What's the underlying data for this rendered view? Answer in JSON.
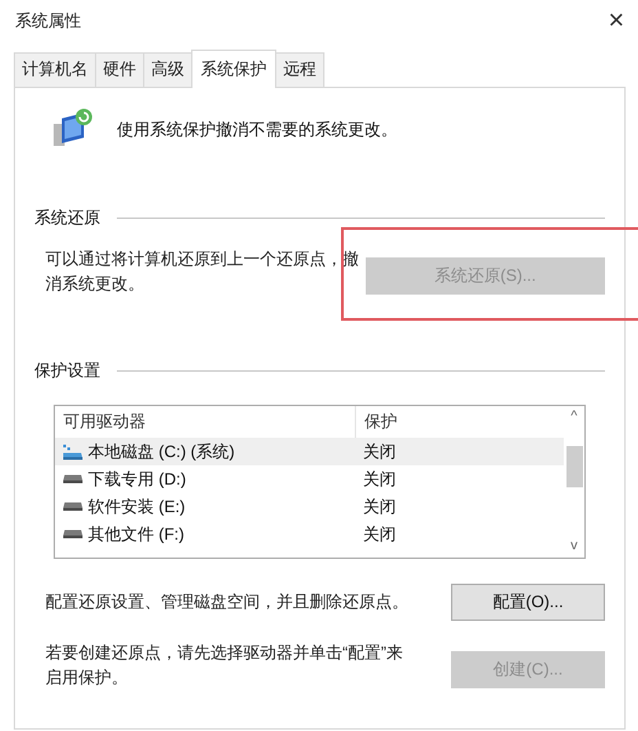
{
  "window": {
    "title": "系统属性",
    "close": "×"
  },
  "tabs": [
    {
      "label": "计算机名",
      "selected": false
    },
    {
      "label": "硬件",
      "selected": false
    },
    {
      "label": "高级",
      "selected": false
    },
    {
      "label": "系统保护",
      "selected": true
    },
    {
      "label": "远程",
      "selected": false
    }
  ],
  "intro": "使用系统保护撤消不需要的系统更改。",
  "restore_section": {
    "heading": "系统还原",
    "description": "可以通过将计算机还原到上一个还原点，撤消系统更改。",
    "button": {
      "label": "系统还原(S)...",
      "disabled": true,
      "highlighted": true
    }
  },
  "protection_section": {
    "heading": "保护设置",
    "table": {
      "columns": [
        "可用驱动器",
        "保护"
      ],
      "rows": [
        {
          "kind": "system",
          "name": "本地磁盘 (C:) (系统)",
          "protection": "关闭",
          "selected": true
        },
        {
          "kind": "drive",
          "name": "下载专用 (D:)",
          "protection": "关闭",
          "selected": false
        },
        {
          "kind": "drive",
          "name": "软件安装 (E:)",
          "protection": "关闭",
          "selected": false
        },
        {
          "kind": "drive",
          "name": "其他文件 (F:)",
          "protection": "关闭",
          "selected": false
        }
      ],
      "scroll_up": "^",
      "scroll_down": "v"
    },
    "configure": {
      "text": "配置还原设置、管理磁盘空间，并且删除还原点。",
      "button": {
        "label": "配置(O)...",
        "disabled": false
      }
    },
    "create": {
      "text": "若要创建还原点，请先选择驱动器并单击“配置”来启用保护。",
      "button": {
        "label": "创建(C)...",
        "disabled": true
      }
    }
  }
}
